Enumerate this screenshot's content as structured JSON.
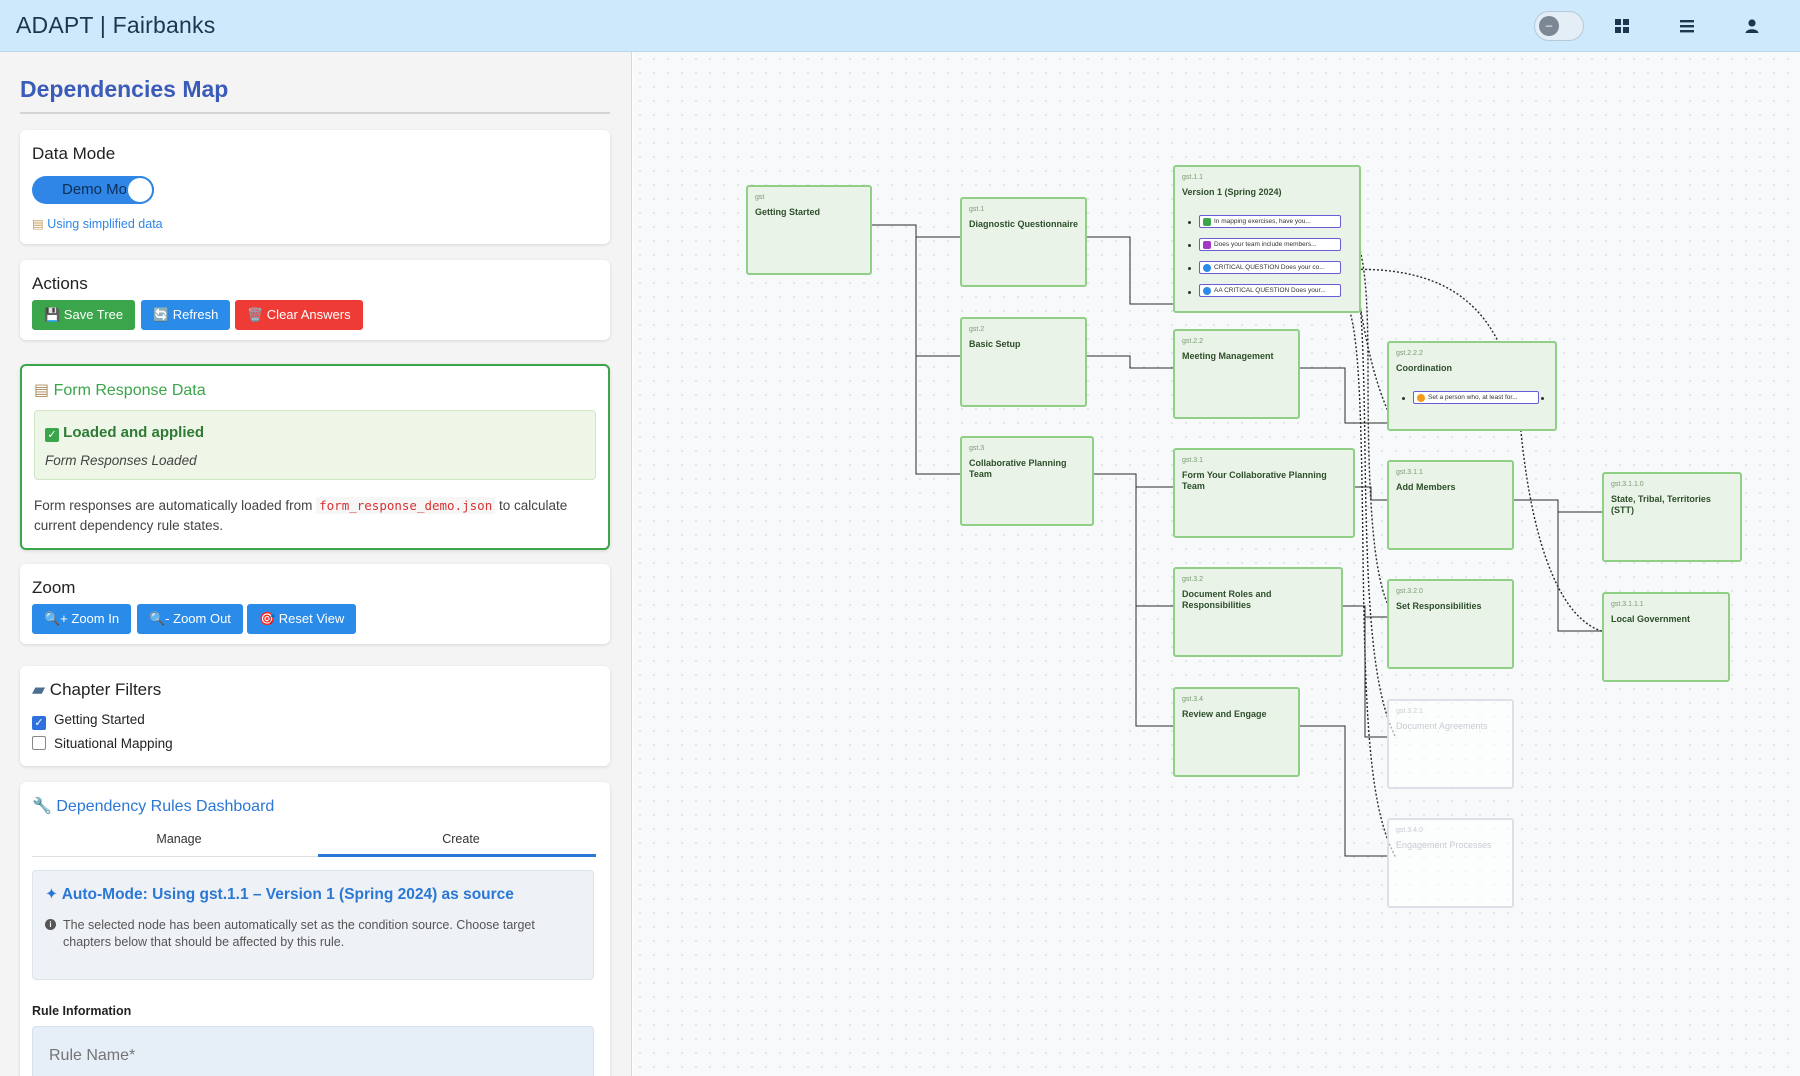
{
  "header": {
    "brand": "ADAPT | Fairbanks",
    "icons": [
      "theme-toggle-icon",
      "grid-icon",
      "menu-icon",
      "user-icon"
    ]
  },
  "sidebar": {
    "page_title": "Dependencies Map",
    "data_mode": {
      "heading": "Data Mode",
      "toggle_label": "Demo Mode",
      "note": "Using simplified data"
    },
    "actions": {
      "heading": "Actions",
      "save": "💾 Save Tree",
      "refresh": "🔄 Refresh",
      "clear": "🗑️ Clear Answers"
    },
    "form_response": {
      "heading": "Form Response Data",
      "status": "Loaded and applied",
      "status_sub": "Form Responses Loaded",
      "desc_before": "Form responses are automatically loaded from ",
      "file": "form_response_demo.json",
      "desc_after": " to calculate current dependency rule states."
    },
    "zoom": {
      "heading": "Zoom",
      "zoom_in": "🔍+ Zoom In",
      "zoom_out": "🔍- Zoom Out",
      "reset": "🎯 Reset View"
    },
    "chapter_filters": {
      "heading": "Chapter Filters",
      "items": [
        {
          "label": "Getting Started",
          "checked": true
        },
        {
          "label": "Situational Mapping",
          "checked": false
        }
      ]
    },
    "rules": {
      "heading": "Dependency Rules Dashboard",
      "tabs": [
        "Manage",
        "Create"
      ],
      "active_tab": "Create",
      "auto_title": "Auto-Mode: Using gst.1.1 – Version 1 (Spring 2024) as source",
      "auto_desc": "The selected node has been automatically set as the condition source. Choose target chapters below that should be affected by this rule.",
      "rule_info_label": "Rule Information",
      "rule_name_placeholder": "Rule Name*"
    }
  },
  "map": {
    "nodes": [
      {
        "id": "gst",
        "title": "Getting Started"
      },
      {
        "id": "gst.1",
        "title": "Diagnostic Questionnaire"
      },
      {
        "id": "gst.1.1",
        "title": "Version 1 (Spring 2024)"
      },
      {
        "id": "gst.2",
        "title": "Basic Setup"
      },
      {
        "id": "gst.2.2",
        "title": "Meeting Management"
      },
      {
        "id": "gst.2.2.2",
        "title": "Coordination"
      },
      {
        "id": "gst.3",
        "title": "Collaborative Planning Team"
      },
      {
        "id": "gst.3.1",
        "title": "Form Your Collaborative Planning Team"
      },
      {
        "id": "gst.3.1.1",
        "title": "Add Members"
      },
      {
        "id": "gst.3.1.1.0",
        "title": "State, Tribal, Territories (STT)"
      },
      {
        "id": "gst.3.1.1.1",
        "title": "Local Government"
      },
      {
        "id": "gst.3.2",
        "title": "Document Roles and Responsibilities"
      },
      {
        "id": "gst.3.2.0",
        "title": "Set Responsibilities"
      },
      {
        "id": "gst.3.2.1",
        "title": "Document Agreements"
      },
      {
        "id": "gst.3.4",
        "title": "Review and Engage"
      },
      {
        "id": "gst.3.4.0",
        "title": "Engagement Processes"
      }
    ],
    "questions": [
      {
        "text": "In mapping exercises, have you...",
        "color": "#3aa54a"
      },
      {
        "text": "Does your team include members...",
        "color": "#a237c8"
      },
      {
        "text": "CRITICAL QUESTION Does your co...",
        "color": "#2b8be8"
      },
      {
        "text": "AA CRITICAL QUESTION Does your...",
        "color": "#2b8be8"
      }
    ],
    "coordination_item": {
      "text": "Set a person who, at least for...",
      "color": "#f39a1a"
    }
  }
}
